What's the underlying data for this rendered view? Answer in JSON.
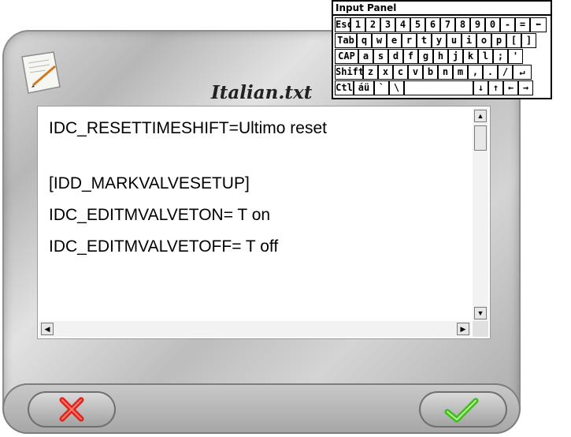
{
  "window": {
    "title": "Italian.txt"
  },
  "document": {
    "lines": [
      "IDC_RESETTIMESHIFT=Ultimo reset",
      "[IDD_MARKVALVESETUP]",
      "IDC_EDITMVALVETON= T on",
      "IDC_EDITMVALVETOFF= T off"
    ]
  },
  "input_panel": {
    "title": "Input Panel",
    "rows": [
      [
        "Esc",
        "1",
        "2",
        "3",
        "4",
        "5",
        "6",
        "7",
        "8",
        "9",
        "0",
        "-",
        "=",
        "⬅"
      ],
      [
        "Tab",
        "q",
        "w",
        "e",
        "r",
        "t",
        "y",
        "u",
        "i",
        "o",
        "p",
        "[",
        "]"
      ],
      [
        "CAP",
        "a",
        "s",
        "d",
        "f",
        "g",
        "h",
        "j",
        "k",
        "l",
        ";",
        "'"
      ],
      [
        "Shift",
        "z",
        "x",
        "c",
        "v",
        "b",
        "n",
        "m",
        ",",
        ".",
        "/",
        "↵"
      ],
      [
        "Ctl",
        "áü",
        "`",
        "\\",
        "",
        "↓",
        "↑",
        "←",
        "→"
      ]
    ]
  },
  "buttons": {
    "cancel": "cancel-x-icon",
    "ok": "ok-check-icon"
  },
  "colors": {
    "cancel": "#e0241b",
    "ok": "#3cbf1a",
    "frame": "#c4c4c4"
  }
}
